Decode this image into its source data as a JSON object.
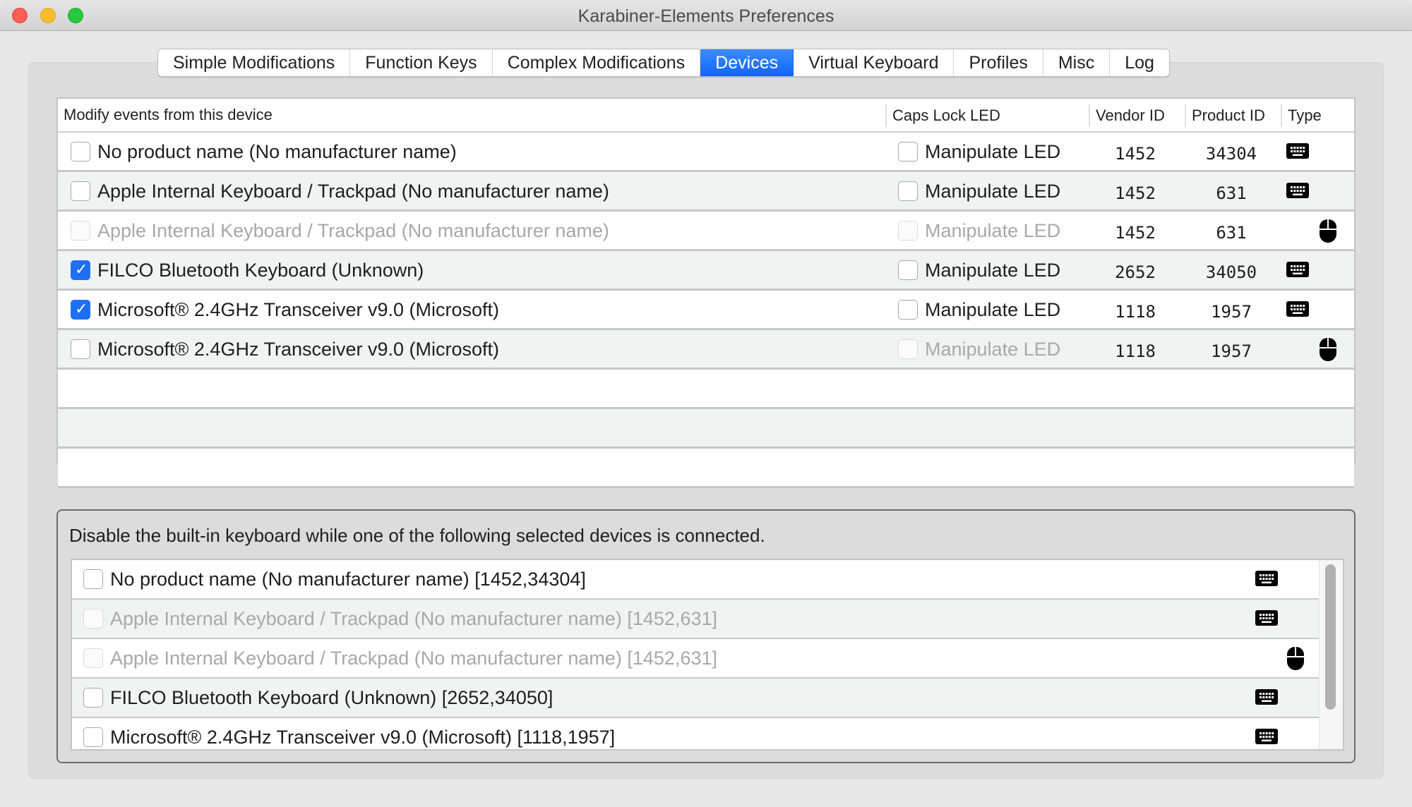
{
  "window": {
    "title": "Karabiner-Elements Preferences"
  },
  "tabs": [
    {
      "label": "Simple Modifications",
      "active": false
    },
    {
      "label": "Function Keys",
      "active": false
    },
    {
      "label": "Complex Modifications",
      "active": false
    },
    {
      "label": "Devices",
      "active": true
    },
    {
      "label": "Virtual Keyboard",
      "active": false
    },
    {
      "label": "Profiles",
      "active": false
    },
    {
      "label": "Misc",
      "active": false
    },
    {
      "label": "Log",
      "active": false
    }
  ],
  "colors": {
    "accent": "#1e6ff5",
    "tab_active_top": "#3c8cfd",
    "tab_active_bottom": "#1166fb",
    "disabled_text": "#a8a8a8"
  },
  "devices_table": {
    "columns": [
      "Modify events from this device",
      "Caps Lock LED",
      "Vendor ID",
      "Product ID",
      "Type"
    ],
    "rows": [
      {
        "name": "No product name (No manufacturer name)",
        "modify_checked": false,
        "modify_enabled": true,
        "led_label": "Manipulate LED",
        "led_checked": false,
        "led_enabled": true,
        "vendor_id": "1452",
        "product_id": "34304",
        "type": "keyboard-icon"
      },
      {
        "name": "Apple Internal Keyboard / Trackpad (No manufacturer name)",
        "modify_checked": false,
        "modify_enabled": true,
        "led_label": "Manipulate LED",
        "led_checked": false,
        "led_enabled": true,
        "vendor_id": "1452",
        "product_id": "631",
        "type": "keyboard-icon"
      },
      {
        "name": "Apple Internal Keyboard / Trackpad (No manufacturer name)",
        "modify_checked": false,
        "modify_enabled": false,
        "led_label": "Manipulate LED",
        "led_checked": false,
        "led_enabled": false,
        "vendor_id": "1452",
        "product_id": "631",
        "type": "mouse-icon"
      },
      {
        "name": "FILCO Bluetooth Keyboard (Unknown)",
        "modify_checked": true,
        "modify_enabled": true,
        "led_label": "Manipulate LED",
        "led_checked": false,
        "led_enabled": true,
        "vendor_id": "2652",
        "product_id": "34050",
        "type": "keyboard-icon"
      },
      {
        "name": "Microsoft® 2.4GHz Transceiver v9.0 (Microsoft)",
        "modify_checked": true,
        "modify_enabled": true,
        "led_label": "Manipulate LED",
        "led_checked": false,
        "led_enabled": true,
        "vendor_id": "1118",
        "product_id": "1957",
        "type": "keyboard-icon"
      },
      {
        "name": "Microsoft® 2.4GHz Transceiver v9.0 (Microsoft)",
        "modify_checked": false,
        "modify_enabled": true,
        "led_label": "Manipulate LED",
        "led_checked": false,
        "led_enabled": false,
        "vendor_id": "1118",
        "product_id": "1957",
        "type": "mouse-icon"
      }
    ],
    "empty_rows": 3
  },
  "disable_builtin": {
    "label": "Disable the built-in keyboard while one of the following selected devices is connected.",
    "items": [
      {
        "label": "No product name (No manufacturer name) [1452,34304]",
        "checked": false,
        "enabled": true,
        "type": "keyboard-icon"
      },
      {
        "label": "Apple Internal Keyboard / Trackpad (No manufacturer name) [1452,631]",
        "checked": false,
        "enabled": false,
        "type": "keyboard-icon"
      },
      {
        "label": "Apple Internal Keyboard / Trackpad (No manufacturer name) [1452,631]",
        "checked": false,
        "enabled": false,
        "type": "mouse-icon"
      },
      {
        "label": "FILCO Bluetooth Keyboard (Unknown) [2652,34050]",
        "checked": false,
        "enabled": true,
        "type": "keyboard-icon"
      },
      {
        "label": "Microsoft® 2.4GHz Transceiver v9.0 (Microsoft) [1118,1957]",
        "checked": false,
        "enabled": true,
        "type": "keyboard-icon"
      }
    ]
  }
}
